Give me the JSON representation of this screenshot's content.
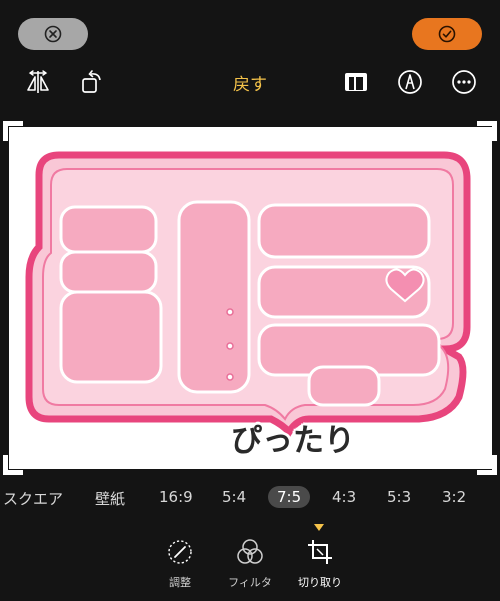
{
  "header": {
    "cancel_icon": "x-circle-icon",
    "done_icon": "checkmark-circle-icon",
    "revert_label": "戻す",
    "colors": {
      "cancel_bg": "#a7a7a7",
      "done_bg": "#e8761f",
      "accent": "#f5c34a"
    }
  },
  "tools": {
    "left": [
      "flip-horizontal-icon",
      "rotate-icon"
    ],
    "right": [
      "aspect-ratio-icon",
      "markup-pen-icon",
      "more-icon"
    ]
  },
  "photo": {
    "caption": "ぴったり",
    "colors": {
      "frame_pink": "#ec4a82",
      "fill_pink": "#f8b8cc",
      "heart": "#f59ab6"
    }
  },
  "aspect_ratios": {
    "items": [
      "スクエア",
      "壁紙",
      "16:9",
      "5:4",
      "7:5",
      "4:3",
      "5:3",
      "3:2"
    ],
    "selected": "7:5"
  },
  "bottom_tabs": [
    {
      "label": "調整",
      "icon": "adjust-dial-icon",
      "active": false
    },
    {
      "label": "フィルタ",
      "icon": "filter-circles-icon",
      "active": false
    },
    {
      "label": "切り取り",
      "icon": "crop-icon",
      "active": true
    }
  ]
}
